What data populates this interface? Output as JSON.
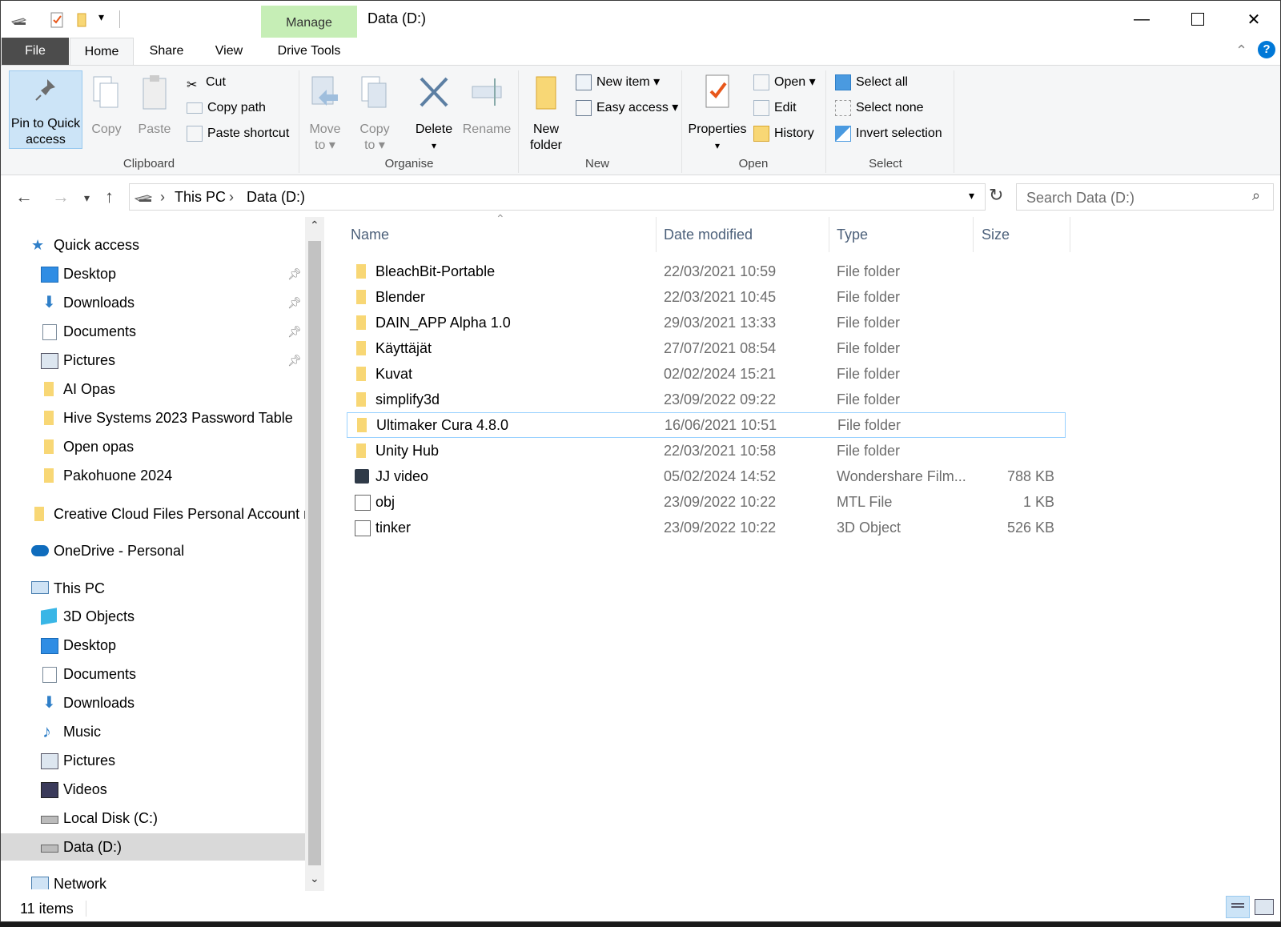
{
  "window": {
    "title": "Data (D:)",
    "manage_tab": "Manage"
  },
  "ribbon_tabs": [
    "File",
    "Home",
    "Share",
    "View",
    "Drive Tools"
  ],
  "clipboard": {
    "pin_label_1": "Pin to Quick",
    "pin_label_2": "access",
    "copy": "Copy",
    "paste": "Paste",
    "cut": "Cut",
    "copy_path": "Copy path",
    "paste_shortcut": "Paste shortcut",
    "group": "Clipboard"
  },
  "organise": {
    "move_1": "Move",
    "move_2": "to",
    "copy_1": "Copy",
    "copy_2": "to",
    "delete": "Delete",
    "rename": "Rename",
    "group": "Organise"
  },
  "new": {
    "new_folder_1": "New",
    "new_folder_2": "folder",
    "new_item": "New item",
    "easy_access": "Easy access",
    "group": "New"
  },
  "open": {
    "properties": "Properties",
    "open": "Open",
    "edit": "Edit",
    "history": "History",
    "group": "Open"
  },
  "select": {
    "select_all": "Select all",
    "select_none": "Select none",
    "invert": "Invert selection",
    "group": "Select"
  },
  "address": {
    "crumb1": "This PC",
    "crumb2": "Data (D:)"
  },
  "search": {
    "placeholder": "Search Data (D:)"
  },
  "nav": {
    "quick_access": "Quick access",
    "quick_items": [
      "Desktop",
      "Downloads",
      "Documents",
      "Pictures",
      "AI Opas",
      "Hive Systems 2023 Password Table",
      "Open opas",
      "Pakohuone 2024"
    ],
    "creative_cloud": "Creative Cloud Files Personal Account m",
    "onedrive": "OneDrive - Personal",
    "this_pc": "This PC",
    "pc_items": [
      "3D Objects",
      "Desktop",
      "Documents",
      "Downloads",
      "Music",
      "Pictures",
      "Videos",
      "Local Disk (C:)",
      "Data (D:)"
    ],
    "network": "Network"
  },
  "columns": {
    "name": "Name",
    "date": "Date modified",
    "type": "Type",
    "size": "Size"
  },
  "files": [
    {
      "name": "BleachBit-Portable",
      "date": "22/03/2021 10:59",
      "type": "File folder",
      "size": ""
    },
    {
      "name": "Blender",
      "date": "22/03/2021 10:45",
      "type": "File folder",
      "size": ""
    },
    {
      "name": "DAIN_APP Alpha 1.0",
      "date": "29/03/2021 13:33",
      "type": "File folder",
      "size": ""
    },
    {
      "name": "Käyttäjät",
      "date": "27/07/2021 08:54",
      "type": "File folder",
      "size": ""
    },
    {
      "name": "Kuvat",
      "date": "02/02/2024 15:21",
      "type": "File folder",
      "size": ""
    },
    {
      "name": "simplify3d",
      "date": "23/09/2022 09:22",
      "type": "File folder",
      "size": ""
    },
    {
      "name": "Ultimaker Cura 4.8.0",
      "date": "16/06/2021 10:51",
      "type": "File folder",
      "size": ""
    },
    {
      "name": "Unity Hub",
      "date": "22/03/2021 10:58",
      "type": "File folder",
      "size": ""
    },
    {
      "name": "JJ video",
      "date": "05/02/2024 14:52",
      "type": "Wondershare Film...",
      "size": "788 KB"
    },
    {
      "name": "obj",
      "date": "23/09/2022 10:22",
      "type": "MTL File",
      "size": "1 KB"
    },
    {
      "name": "tinker",
      "date": "23/09/2022 10:22",
      "type": "3D Object",
      "size": "526 KB"
    }
  ],
  "status": {
    "count": "11 items"
  },
  "colors": {
    "folder": "#f8d775",
    "accent": "#0078d7",
    "manage_bg": "#c6eeb6"
  }
}
